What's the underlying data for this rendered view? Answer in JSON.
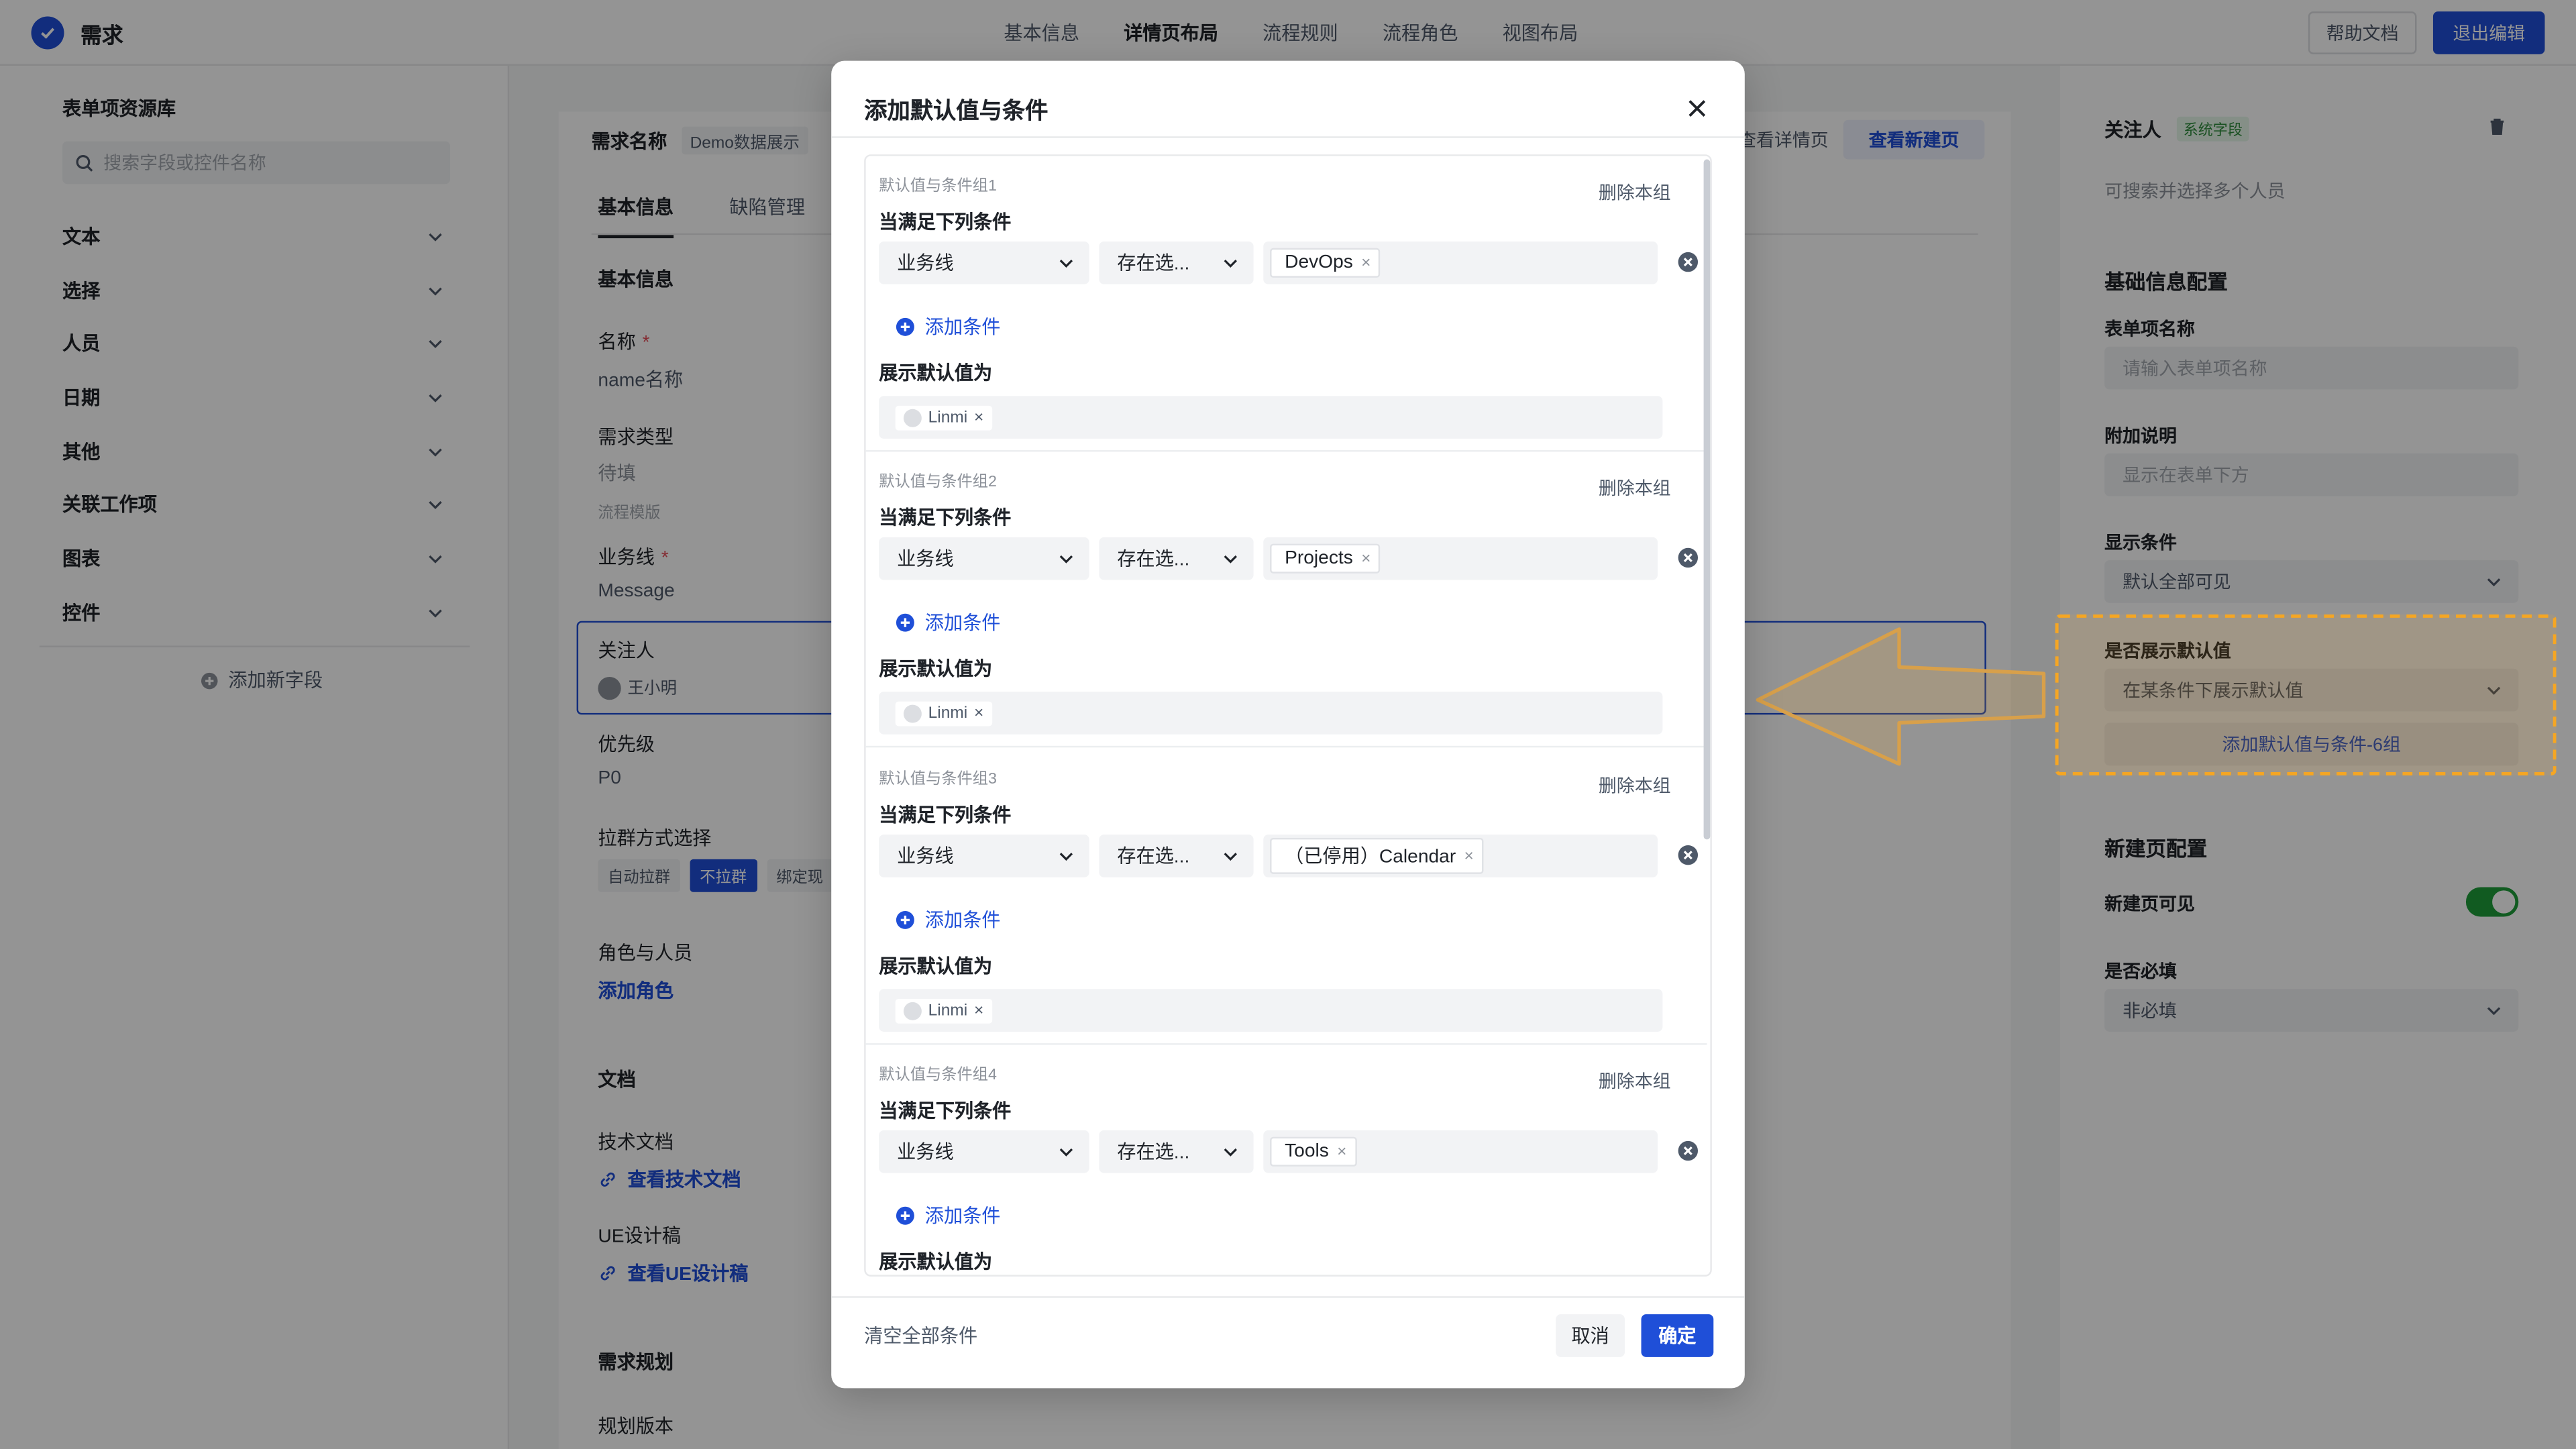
{
  "app": {
    "title": "需求"
  },
  "nav": {
    "items": [
      "基本信息",
      "详情页布局",
      "流程规则",
      "流程角色",
      "视图布局"
    ],
    "active": "详情页布局"
  },
  "header": {
    "help_label": "帮助文档",
    "exit_label": "退出编辑"
  },
  "sidebar": {
    "title": "表单项资源库",
    "search_placeholder": "搜索字段或控件名称",
    "categories": [
      "文本",
      "选择",
      "人员",
      "日期",
      "其他",
      "关联工作项",
      "图表",
      "控件"
    ],
    "add_field": "添加新字段"
  },
  "preview": {
    "title": "需求名称",
    "demo_tag": "Demo数据展示",
    "view_detail": "查看详情页",
    "view_new": "查看新建页",
    "tabs": [
      "基本信息",
      "缺陷管理"
    ],
    "section_basic": "基本信息",
    "name_label": "名称",
    "name_value": "name名称",
    "type_label": "需求类型",
    "type_value": "待填",
    "type_sub": "流程模版",
    "biz_label": "业务线",
    "biz_value": "Message",
    "watcher_label": "关注人",
    "watcher_value": "王小明",
    "priority_label": "优先级",
    "priority_value": "P0",
    "group_label": "拉群方式选择",
    "group_options": [
      "自动拉群",
      "不拉群",
      "绑定现"
    ],
    "role_label": "角色与人员",
    "role_link": "添加角色",
    "doc_section": "文档",
    "tech_doc_label": "技术文档",
    "tech_doc_link": "查看技术文档",
    "ue_label": "UE设计稿",
    "ue_link": "查看UE设计稿",
    "plan_section": "需求规划",
    "plan_version": "规划版本",
    "required_mark": "*"
  },
  "right_panel": {
    "field_name": "关注人",
    "sys_tag": "系统字段",
    "field_desc": "可搜索并选择多个人员",
    "basic_config": "基础信息配置",
    "item_name_label": "表单项名称",
    "item_name_placeholder": "请输入表单项名称",
    "extra_label": "附加说明",
    "extra_placeholder": "显示在表单下方",
    "display_cond_label": "显示条件",
    "display_cond_value": "默认全部可见",
    "show_default_label": "是否展示默认值",
    "show_default_value": "在某条件下展示默认值",
    "add_default_btn": "添加默认值与条件-6组",
    "new_page_config": "新建页配置",
    "new_page_visible": "新建页可见",
    "new_page_visible_on": true,
    "required_label": "是否必填",
    "required_value": "非必填"
  },
  "modal": {
    "title": "添加默认值与条件",
    "clear_all": "清空全部条件",
    "cancel": "取消",
    "ok": "确定",
    "cond_heading": "当满足下列条件",
    "add_condition": "添加条件",
    "show_default_heading": "展示默认值为",
    "delete_group": "删除本组",
    "groups": [
      {
        "title": "默认值与条件组1",
        "field": "业务线",
        "op": "存在选...",
        "value": "DevOps",
        "user": "Linmi"
      },
      {
        "title": "默认值与条件组2",
        "field": "业务线",
        "op": "存在选...",
        "value": "Projects",
        "user": "Linmi"
      },
      {
        "title": "默认值与条件组3",
        "field": "业务线",
        "op": "存在选...",
        "value": "（已停用）Calendar",
        "user": "Linmi"
      },
      {
        "title": "默认值与条件组4",
        "field": "业务线",
        "op": "存在选...",
        "value": "Tools",
        "user": ""
      }
    ]
  },
  "colors": {
    "accent": "#1f4fd8",
    "highlight": "#f5a623",
    "toggle_on": "#1e9e3a"
  }
}
